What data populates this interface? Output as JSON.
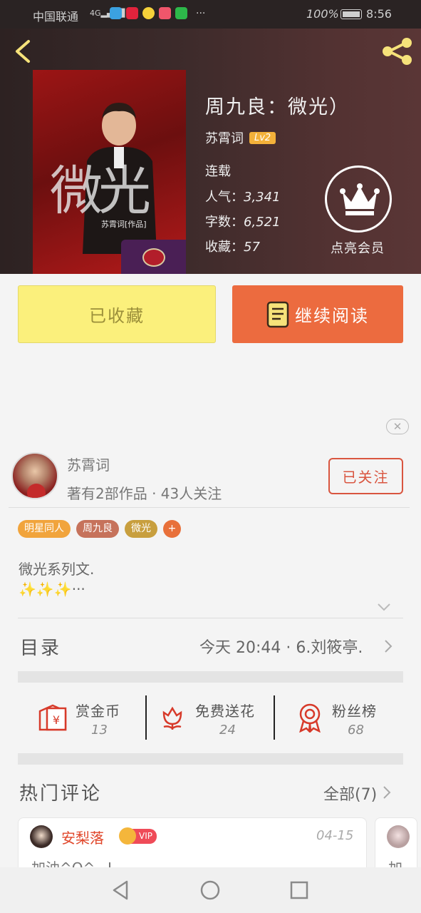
{
  "status_bar": {
    "carrier": "中国联通",
    "signal": "4G",
    "more": "···",
    "battery": "100%",
    "time": "8:56"
  },
  "book": {
    "cover_title": "微光",
    "cover_subtitle": "苏霄词[作品]",
    "title": "周九良：微光）",
    "author": "苏霄词",
    "level": "Lv2",
    "status": "连载",
    "popularity_label": "人气：",
    "popularity": "3,341",
    "words_label": "字数：",
    "words": "6,521",
    "favorites_label": "收藏：",
    "favorites": "57",
    "vip_label": "点亮会员"
  },
  "actions": {
    "collected_label": "已收藏",
    "read_label": "继续阅读"
  },
  "ad_close": "✕",
  "author_card": {
    "name": "苏霄词",
    "stats": "著有2部作品 · 43人关注",
    "follow_label": "已关注"
  },
  "tags": [
    {
      "label": "明星同人",
      "color": "#f1a43c"
    },
    {
      "label": "周九良",
      "color": "#c6725b"
    },
    {
      "label": "微光",
      "color": "#c89f3e"
    }
  ],
  "tag_add": "+",
  "description": {
    "line1": "微光系列文.",
    "line2": "✨✨✨···"
  },
  "toc": {
    "title": "目录",
    "latest": "今天 20:44 · 6.刘筱亭."
  },
  "rewards": [
    {
      "label": "赏金币",
      "count": "13",
      "icon": "red-envelope-icon"
    },
    {
      "label": "免费送花",
      "count": "24",
      "icon": "flower-icon"
    },
    {
      "label": "粉丝榜",
      "count": "68",
      "icon": "medal-icon"
    }
  ],
  "comments": {
    "title": "热门评论",
    "all_label": "全部(7)",
    "items": [
      {
        "user": "安梨落",
        "badge": "VIP",
        "date": "04-15",
        "text": "加油^O^~!"
      },
      {
        "text": "加"
      }
    ]
  },
  "colors": {
    "accent_orange": "#ec6b3f",
    "collected_yellow": "#fbf07c",
    "follow_red": "#d9553f"
  }
}
